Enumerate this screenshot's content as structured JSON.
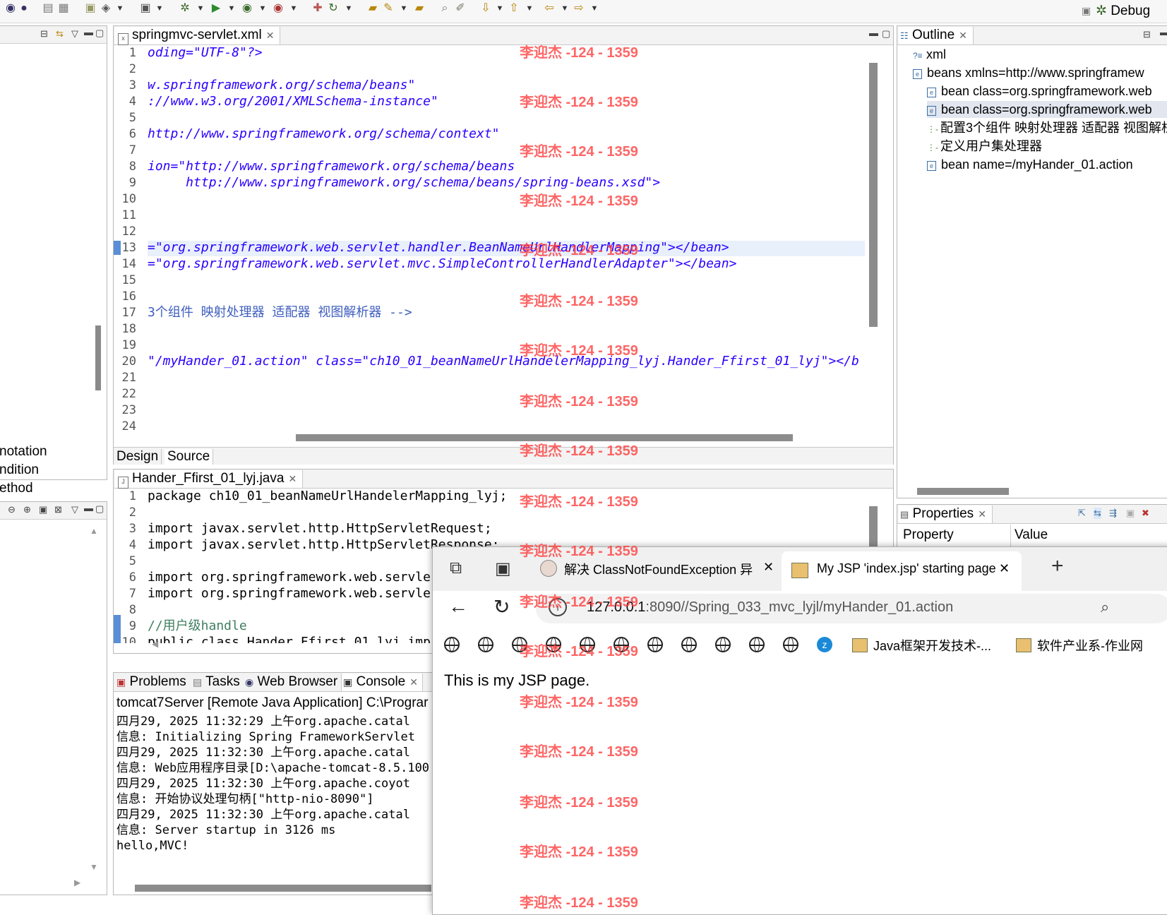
{
  "perspective": {
    "label": "Debug"
  },
  "xml_editor": {
    "tab_title": "springmvc-servlet.xml",
    "lines": [
      {
        "n": "1",
        "text": "oding=\"UTF-8\"?>"
      },
      {
        "n": "2",
        "text": ""
      },
      {
        "n": "3",
        "text": "w.springframework.org/schema/beans\""
      },
      {
        "n": "4",
        "text": "://www.w3.org/2001/XMLSchema-instance\""
      },
      {
        "n": "5",
        "text": ""
      },
      {
        "n": "6",
        "text": "http://www.springframework.org/schema/context\""
      },
      {
        "n": "7",
        "text": ""
      },
      {
        "n": "8",
        "text": "ion=\"http://www.springframework.org/schema/beans"
      },
      {
        "n": "9",
        "text": "     http://www.springframework.org/schema/beans/spring-beans.xsd\">"
      },
      {
        "n": "10",
        "text": ""
      },
      {
        "n": "11",
        "text": ""
      },
      {
        "n": "12",
        "text": ""
      },
      {
        "n": "13",
        "text": "=\"org.springframework.web.servlet.handler.BeanNameUrlHandlerMapping\"></bean>"
      },
      {
        "n": "14",
        "text": "=\"org.springframework.web.servlet.mvc.SimpleControllerHandlerAdapter\"></bean>"
      },
      {
        "n": "15",
        "text": ""
      },
      {
        "n": "16",
        "text": ""
      },
      {
        "n": "17",
        "text": "3个组件 映射处理器 适配器 视图解析器 -->"
      },
      {
        "n": "18",
        "text": ""
      },
      {
        "n": "19",
        "text": ""
      },
      {
        "n": "20",
        "text": "\"/myHander_01.action\" class=\"ch10_01_beanNameUrlHandelerMapping_lyj.Hander_Ffirst_01_lyj\"></b"
      },
      {
        "n": "21",
        "text": ""
      },
      {
        "n": "22",
        "text": ""
      },
      {
        "n": "23",
        "text": ""
      },
      {
        "n": "24",
        "text": ""
      }
    ],
    "bottom_tabs": [
      "Design",
      "Source"
    ]
  },
  "left_panel": {
    "items": [
      "notation",
      "ndition",
      "ethod"
    ]
  },
  "java_editor": {
    "tab_title": "Hander_Ffirst_01_lyj.java",
    "lines": [
      {
        "n": "1",
        "text": "package ch10_01_beanNameUrlHandelerMapping_lyj;"
      },
      {
        "n": "2",
        "text": ""
      },
      {
        "n": "3",
        "text": "import javax.servlet.http.HttpServletRequest;"
      },
      {
        "n": "4",
        "text": "import javax.servlet.http.HttpServletResponse;"
      },
      {
        "n": "5",
        "text": ""
      },
      {
        "n": "6",
        "text": "import org.springframework.web.servle"
      },
      {
        "n": "7",
        "text": "import org.springframework.web.servle"
      },
      {
        "n": "8",
        "text": ""
      },
      {
        "n": "9",
        "text": "//用户级handle"
      },
      {
        "n": "10",
        "text": "public class Hander_Ffirst_01_lyj imp"
      }
    ]
  },
  "outline": {
    "title": "Outline",
    "items": [
      {
        "icon": "?-?",
        "label": "xml"
      },
      {
        "icon": "e",
        "label": "beans xmlns=http://www.springframew"
      },
      {
        "icon": "e",
        "label": "bean class=org.springframework.web"
      },
      {
        "icon": "e",
        "label": "bean class=org.springframework.web"
      },
      {
        "icon": "c",
        "label": "配置3个组件 映射处理器 适配器 视图解析"
      },
      {
        "icon": "c",
        "label": "定义用户集处理器"
      },
      {
        "icon": "e",
        "label": "bean name=/myHander_01.action"
      }
    ]
  },
  "properties": {
    "title": "Properties",
    "col_property": "Property",
    "col_value": "Value"
  },
  "console": {
    "tabs": [
      "Problems",
      "Tasks",
      "Web Browser",
      "Console"
    ],
    "header": "tomcat7Server [Remote Java Application] C:\\Prograr",
    "lines": [
      "四月29, 2025 11:32:29 上午org.apache.catal",
      "信息: Initializing Spring FrameworkServlet",
      "四月29, 2025 11:32:30 上午org.apache.catal",
      "信息: Web应用程序目录[D:\\apache-tomcat-8.5.100",
      "四月29, 2025 11:32:30 上午org.apache.coyot",
      "信息: 开始协议处理句柄[\"http-nio-8090\"]",
      "四月29, 2025 11:32:30 上午org.apache.catal",
      "信息: Server startup in 3126 ms",
      "hello,MVC!"
    ]
  },
  "browser": {
    "tabs": [
      {
        "title": "解决 ClassNotFoundException 异常"
      },
      {
        "title": "My JSP 'index.jsp' starting page"
      }
    ],
    "url_host": "127.0.0.1",
    "url_rest": ":8090//Spring_033_mvc_lyjl/myHander_01.action",
    "bookmarks": [
      "Java框架开发技术-...",
      "软件产业系-作业网"
    ],
    "page_text": "This is my JSP page."
  },
  "watermark": {
    "text": "李迎杰 -124 - 1359"
  }
}
